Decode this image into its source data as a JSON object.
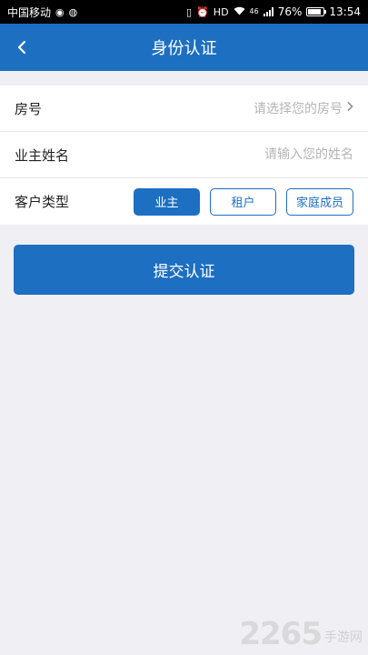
{
  "status_bar": {
    "carrier": "中国移动",
    "network": "46",
    "battery": "76%",
    "time": "13:54"
  },
  "nav": {
    "title": "身份认证"
  },
  "form": {
    "room": {
      "label": "房号",
      "placeholder": "请选择您的房号"
    },
    "name": {
      "label": "业主姓名",
      "placeholder": "请输入您的姓名"
    },
    "customer_type": {
      "label": "客户类型",
      "options": [
        "业主",
        "租户",
        "家庭成员"
      ],
      "selected": "业主"
    }
  },
  "submit_label": "提交认证",
  "watermark": {
    "number": "2265",
    "text": "手游网"
  },
  "colors": {
    "primary": "#1d6fc2",
    "background": "#efeff4"
  }
}
